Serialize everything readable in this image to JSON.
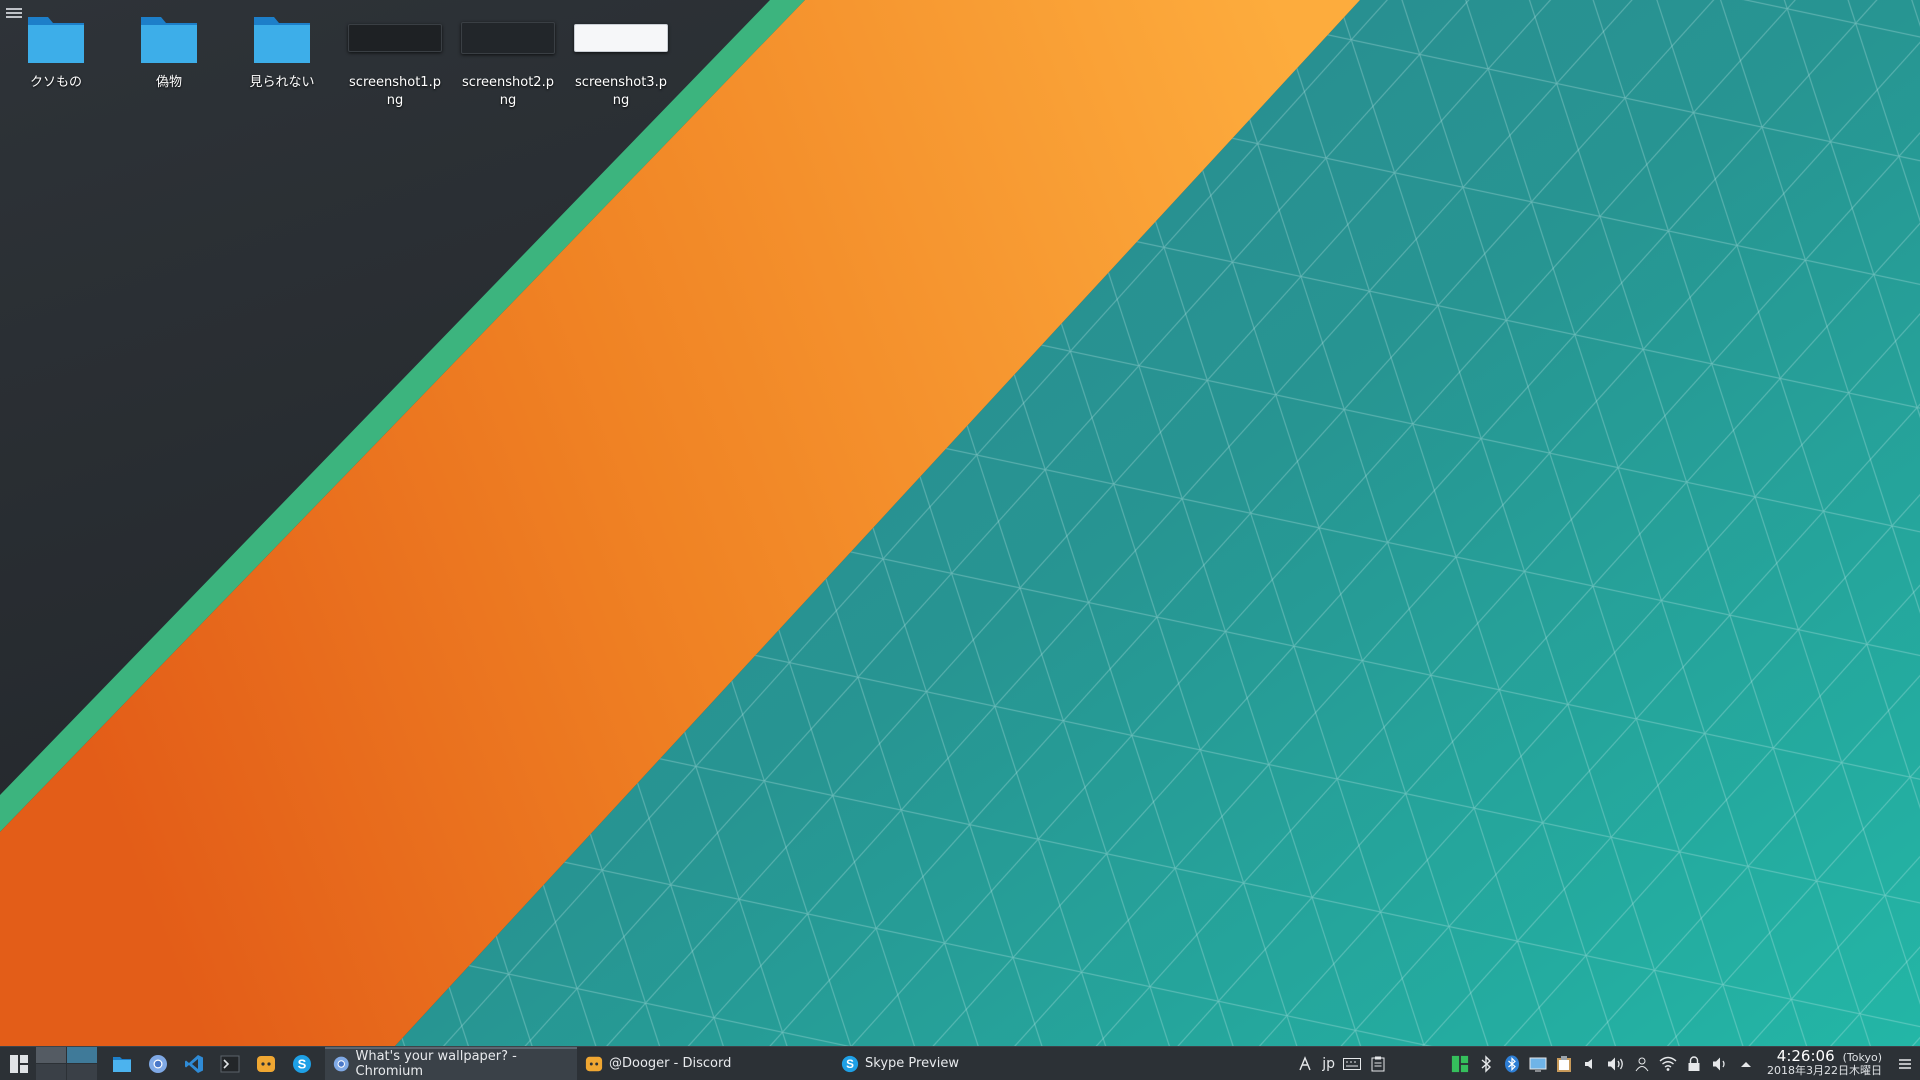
{
  "desktop": {
    "icons": [
      {
        "label": "クソもの",
        "type": "folder-icon"
      },
      {
        "label": "偽物",
        "type": "folder-icon"
      },
      {
        "label": "見られない",
        "type": "folder-icon"
      },
      {
        "label": "screenshot1.png",
        "type": "image-thumbnail"
      },
      {
        "label": "screenshot2.png",
        "type": "image-thumbnail"
      },
      {
        "label": "screenshot3.png",
        "type": "image-thumbnail"
      }
    ]
  },
  "taskbar": {
    "quick_launch": [
      "file-manager-icon",
      "chromium-icon",
      "vscode-icon",
      "terminal-icon",
      "discord-icon",
      "skype-icon"
    ],
    "tasks": [
      {
        "title": "What's your wallpaper? - Chromium",
        "icon": "chromium-icon",
        "active": true
      },
      {
        "title": "@Dooger - Discord",
        "icon": "discord-icon",
        "active": false
      },
      {
        "title": "Skype Preview",
        "icon": "skype-icon",
        "active": false
      }
    ],
    "tray": {
      "input_method": "jp",
      "clock": {
        "time": "4:26:06",
        "timezone": "(Tokyo)",
        "date": "2018年3月22日木曜日"
      }
    }
  },
  "colors": {
    "wallpaper_dark": "#262b30",
    "wallpaper_green": "#3bb27f",
    "wallpaper_orange_start": "#e8651c",
    "wallpaper_orange_end": "#fca63a",
    "wallpaper_teal": "#28918f",
    "taskbar_bg": "#2c3136"
  }
}
